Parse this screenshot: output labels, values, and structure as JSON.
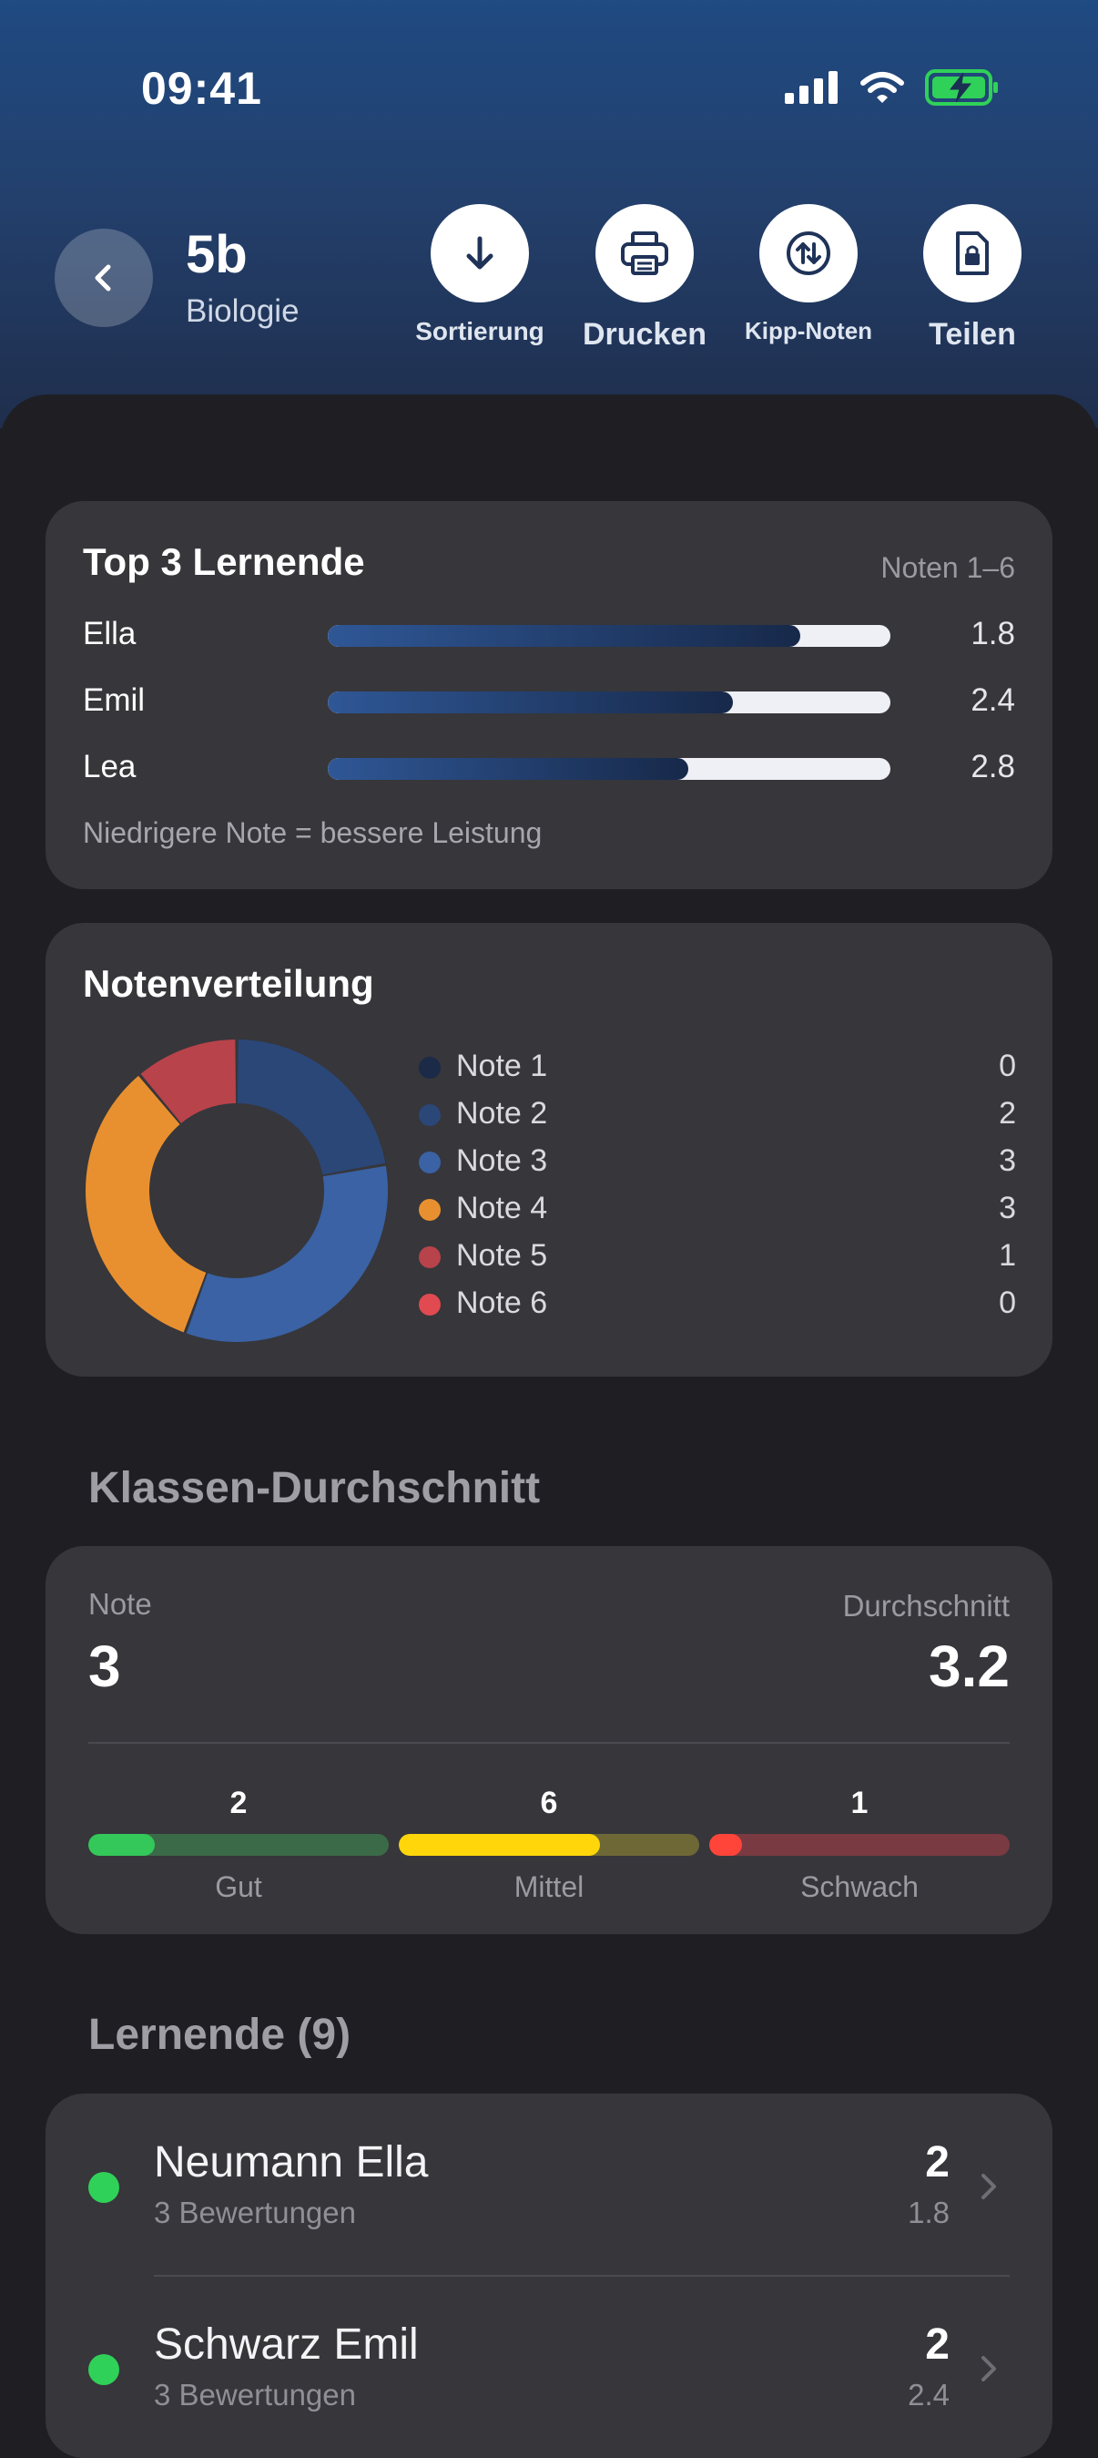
{
  "status": {
    "time": "09:41"
  },
  "header": {
    "title": "5b",
    "subtitle": "Biologie"
  },
  "actions": [
    {
      "label": "Sortierung",
      "icon": "arrow-down-icon"
    },
    {
      "label": "Drucken",
      "icon": "printer-icon"
    },
    {
      "label": "Kipp-Noten",
      "icon": "swap-arrows-icon"
    },
    {
      "label": "Teilen",
      "icon": "locked-document-icon"
    }
  ],
  "top3": {
    "title": "Top 3 Lernende",
    "scale_label": "Noten 1–6",
    "students": [
      {
        "name": "Ella",
        "value": "1.8",
        "bar_fraction": 0.84
      },
      {
        "name": "Emil",
        "value": "2.4",
        "bar_fraction": 0.72
      },
      {
        "name": "Lea",
        "value": "2.8",
        "bar_fraction": 0.64
      }
    ],
    "footnote": "Niedrigere Note = bessere Leistung"
  },
  "distribution": {
    "title": "Notenverteilung",
    "chart_data": {
      "type": "pie",
      "donut": true,
      "categories": [
        "Note 1",
        "Note 2",
        "Note 3",
        "Note 4",
        "Note 5",
        "Note 6"
      ],
      "values": [
        0,
        2,
        3,
        3,
        1,
        0
      ],
      "colors": [
        "#1b2a47",
        "#2a4777",
        "#3a62a4",
        "#e8902f",
        "#b8434b",
        "#e04a50"
      ]
    },
    "legend": [
      {
        "label": "Note 1",
        "count": "0"
      },
      {
        "label": "Note 2",
        "count": "2"
      },
      {
        "label": "Note 3",
        "count": "3"
      },
      {
        "label": "Note 4",
        "count": "3"
      },
      {
        "label": "Note 5",
        "count": "1"
      },
      {
        "label": "Note 6",
        "count": "0"
      }
    ]
  },
  "average": {
    "heading": "Klassen-Durchschnitt",
    "note_label": "Note",
    "note_value": "3",
    "avg_label": "Durchschnitt",
    "avg_value": "3.2",
    "segments": [
      {
        "label": "Gut",
        "count": "2",
        "fraction": 0.22,
        "fill_color": "#34c759",
        "track_color": "#3b6a48"
      },
      {
        "label": "Mittel",
        "count": "6",
        "fraction": 0.67,
        "fill_color": "#ffd60a",
        "track_color": "#6d6835"
      },
      {
        "label": "Schwach",
        "count": "1",
        "fraction": 0.11,
        "fill_color": "#ff453a",
        "track_color": "#7a3a41"
      }
    ]
  },
  "students": {
    "heading": "Lernende (9)",
    "items": [
      {
        "name": "Neumann Ella",
        "sub": "3 Bewertungen",
        "grade": "2",
        "avg": "1.8"
      },
      {
        "name": "Schwarz Emil",
        "sub": "3 Bewertungen",
        "grade": "2",
        "avg": "2.4"
      }
    ]
  }
}
